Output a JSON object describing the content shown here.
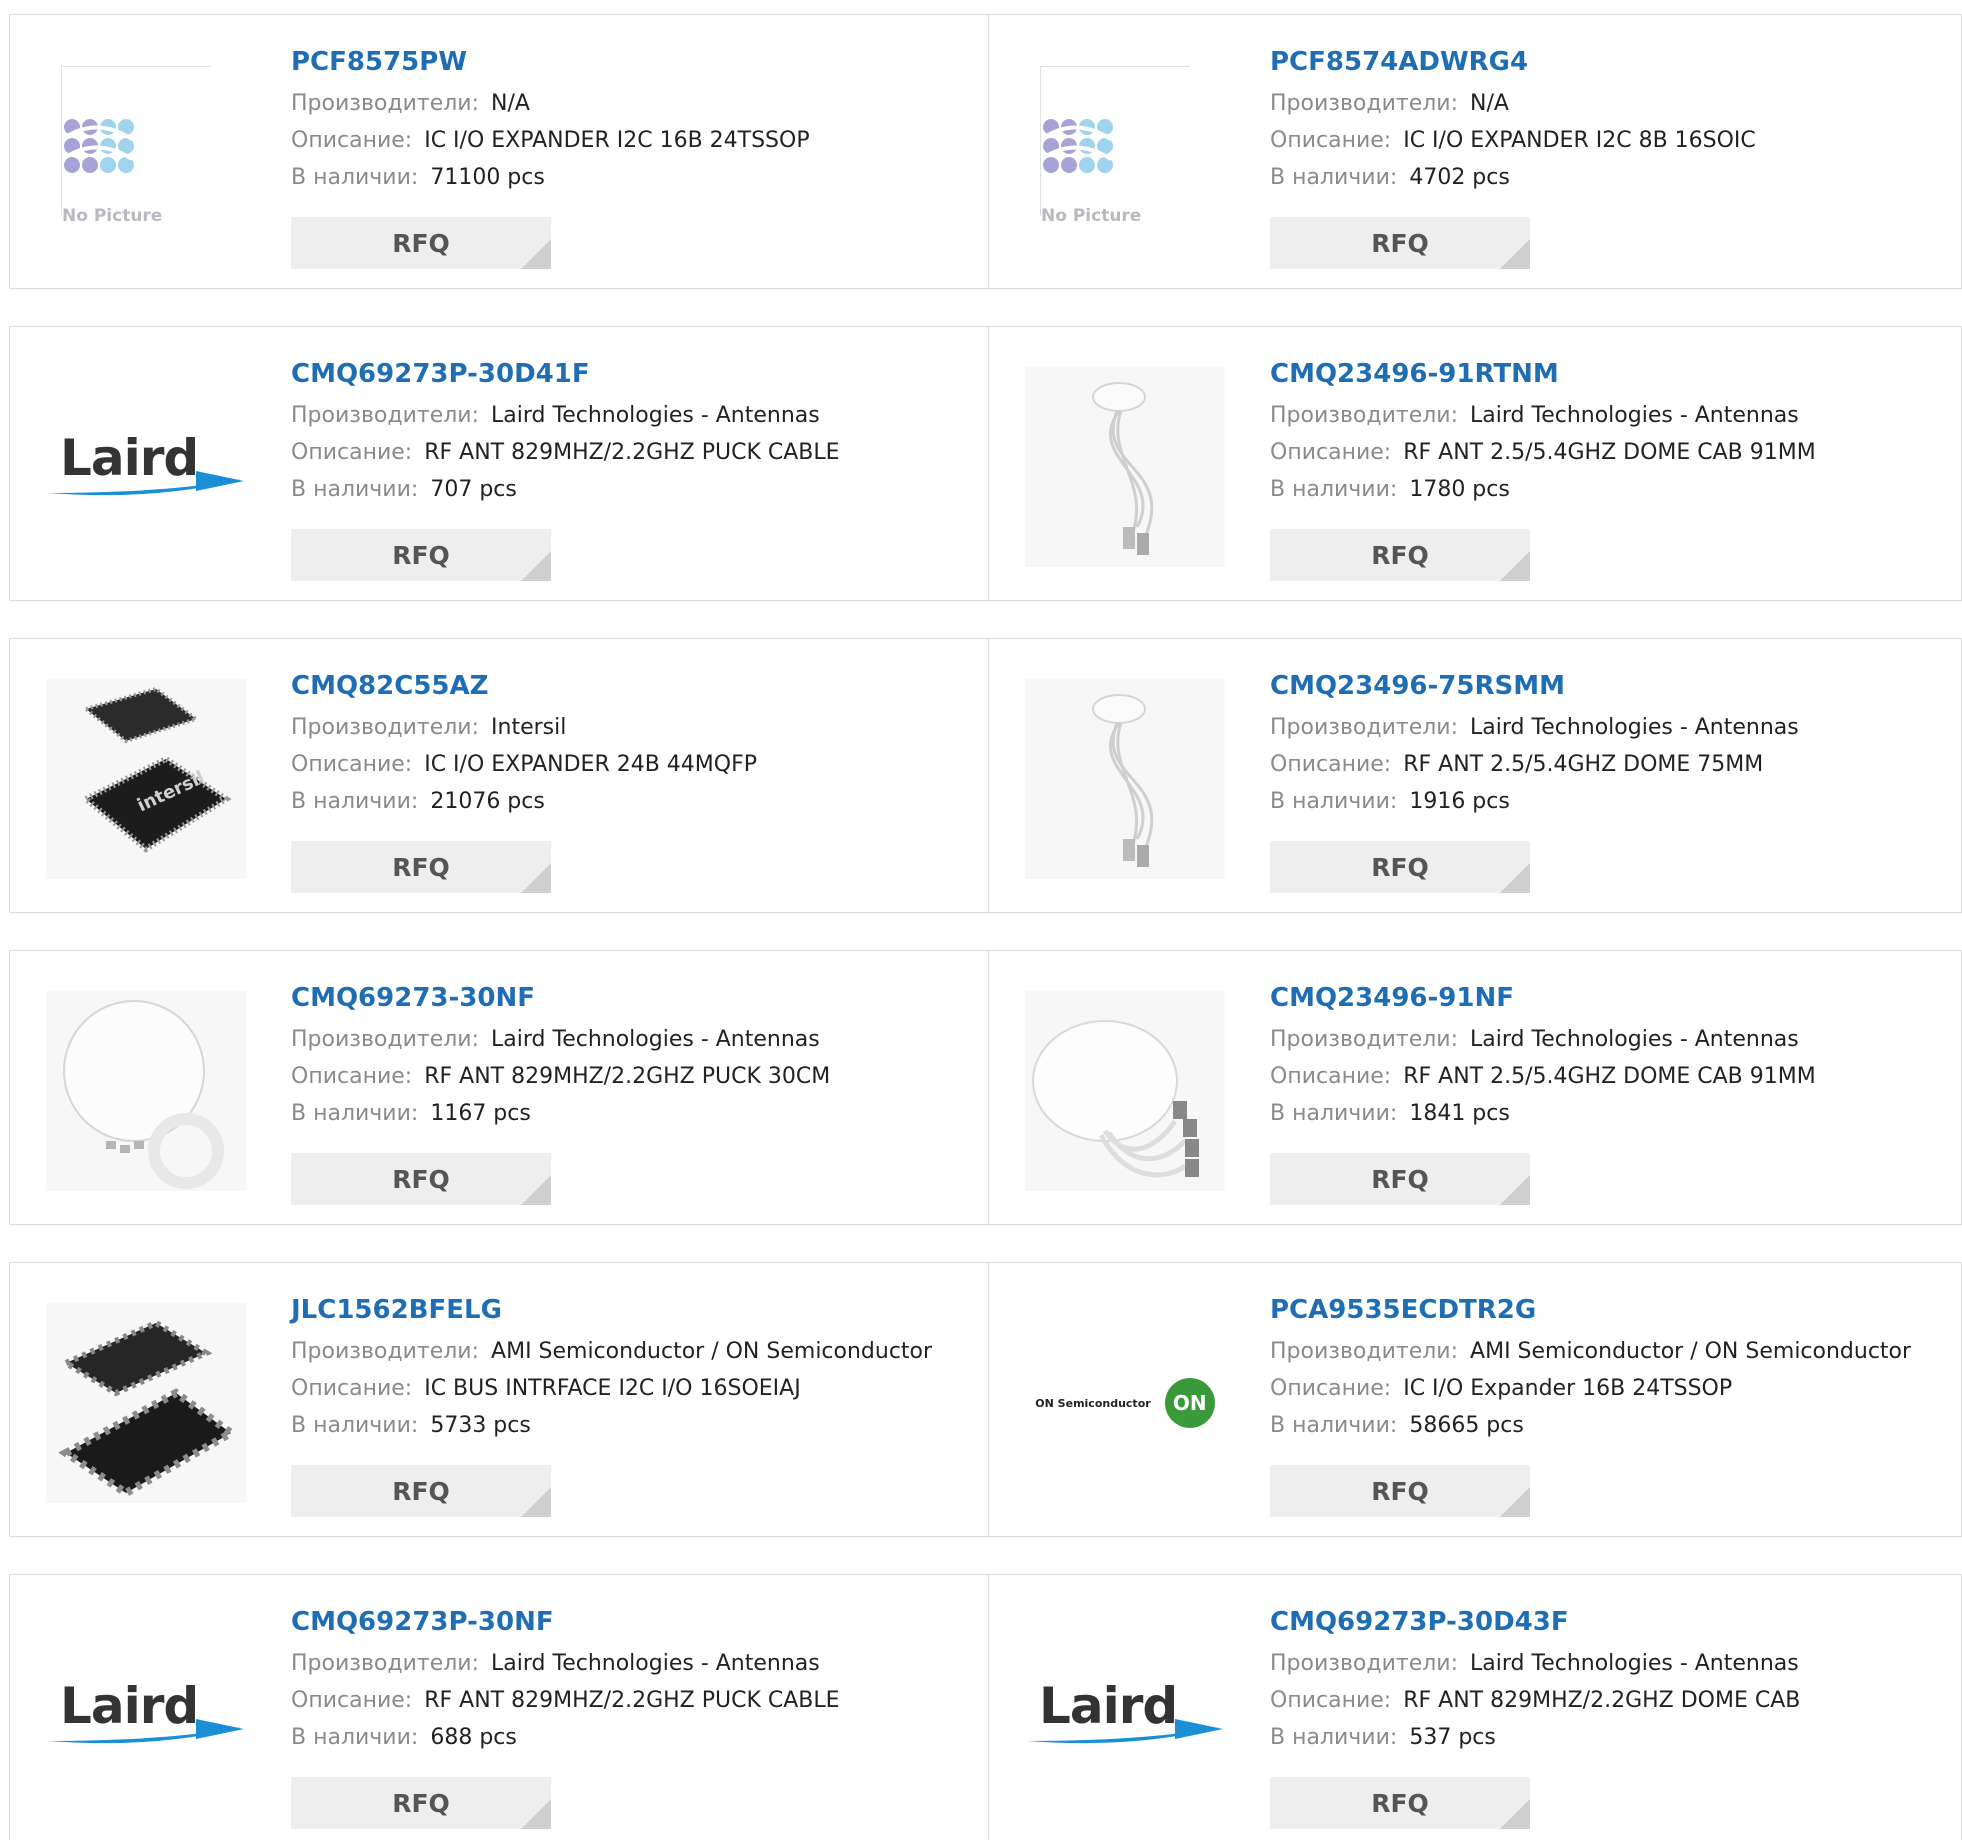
{
  "labels": {
    "manufacturer": "Производители:",
    "description": "Описание:",
    "stock": "В наличии:",
    "rfq": "RFQ",
    "no_picture": "No Picture"
  },
  "products": [
    {
      "pn": "PCF8575PW",
      "mfr": "N/A",
      "desc": "IC I/O EXPANDER I2C 16B 24TSSOP",
      "stock": "71100 pcs",
      "img": "no-picture"
    },
    {
      "pn": "PCF8574ADWRG4",
      "mfr": "N/A",
      "desc": "IC I/O EXPANDER I2C 8B 16SOIC",
      "stock": "4702 pcs",
      "img": "no-picture"
    },
    {
      "pn": "CMQ69273P-30D41F",
      "mfr": "Laird Technologies - Antennas",
      "desc": "RF ANT 829MHZ/2.2GHZ PUCK CABLE",
      "stock": "707 pcs",
      "img": "laird-logo"
    },
    {
      "pn": "CMQ23496-91RTNM",
      "mfr": "Laird Technologies - Antennas",
      "desc": "RF ANT 2.5/5.4GHZ DOME CAB 91MM",
      "stock": "1780 pcs",
      "img": "dome-antenna-cable"
    },
    {
      "pn": "CMQ82C55AZ",
      "mfr": "Intersil",
      "desc": "IC I/O EXPANDER 24B 44MQFP",
      "stock": "21076 pcs",
      "img": "qfp-chip"
    },
    {
      "pn": "CMQ23496-75RSMM",
      "mfr": "Laird Technologies - Antennas",
      "desc": "RF ANT 2.5/5.4GHZ DOME 75MM",
      "stock": "1916 pcs",
      "img": "dome-antenna-cable"
    },
    {
      "pn": "CMQ69273-30NF",
      "mfr": "Laird Technologies - Antennas",
      "desc": "RF ANT 829MHZ/2.2GHZ PUCK 30CM",
      "stock": "1167 pcs",
      "img": "puck-antenna"
    },
    {
      "pn": "CMQ23496-91NF",
      "mfr": "Laird Technologies - Antennas",
      "desc": "RF ANT 2.5/5.4GHZ DOME CAB 91MM",
      "stock": "1841 pcs",
      "img": "dome-antenna-connectors"
    },
    {
      "pn": "JLC1562BFELG",
      "mfr": "AMI Semiconductor / ON Semiconductor",
      "desc": "IC BUS INTRFACE I2C I/O 16SOEIAJ",
      "stock": "5733 pcs",
      "img": "soic-chip"
    },
    {
      "pn": "PCA9535ECDTR2G",
      "mfr": "AMI Semiconductor / ON Semiconductor",
      "desc": "IC I/O Expander 16B 24TSSOP",
      "stock": "58665 pcs",
      "img": "on-semi-logo"
    },
    {
      "pn": "CMQ69273P-30NF",
      "mfr": "Laird Technologies - Antennas",
      "desc": "RF ANT 829MHZ/2.2GHZ PUCK CABLE",
      "stock": "688 pcs",
      "img": "laird-logo"
    },
    {
      "pn": "CMQ69273P-30D43F",
      "mfr": "Laird Technologies - Antennas",
      "desc": "RF ANT 829MHZ/2.2GHZ DOME CAB",
      "stock": "537 pcs",
      "img": "laird-logo"
    }
  ],
  "brand_text": {
    "laird": "Laird",
    "on_semi": "ON Semiconductor",
    "on_badge": "ON",
    "intersil": "intersil"
  },
  "colors": {
    "part_link": "#1f6db3",
    "label": "#8a8a8a",
    "rfq_bg": "#eeeeee",
    "border": "#dcdcdc",
    "laird_swoosh": "#1a8fd6",
    "on_green": "#3a9a3a"
  }
}
